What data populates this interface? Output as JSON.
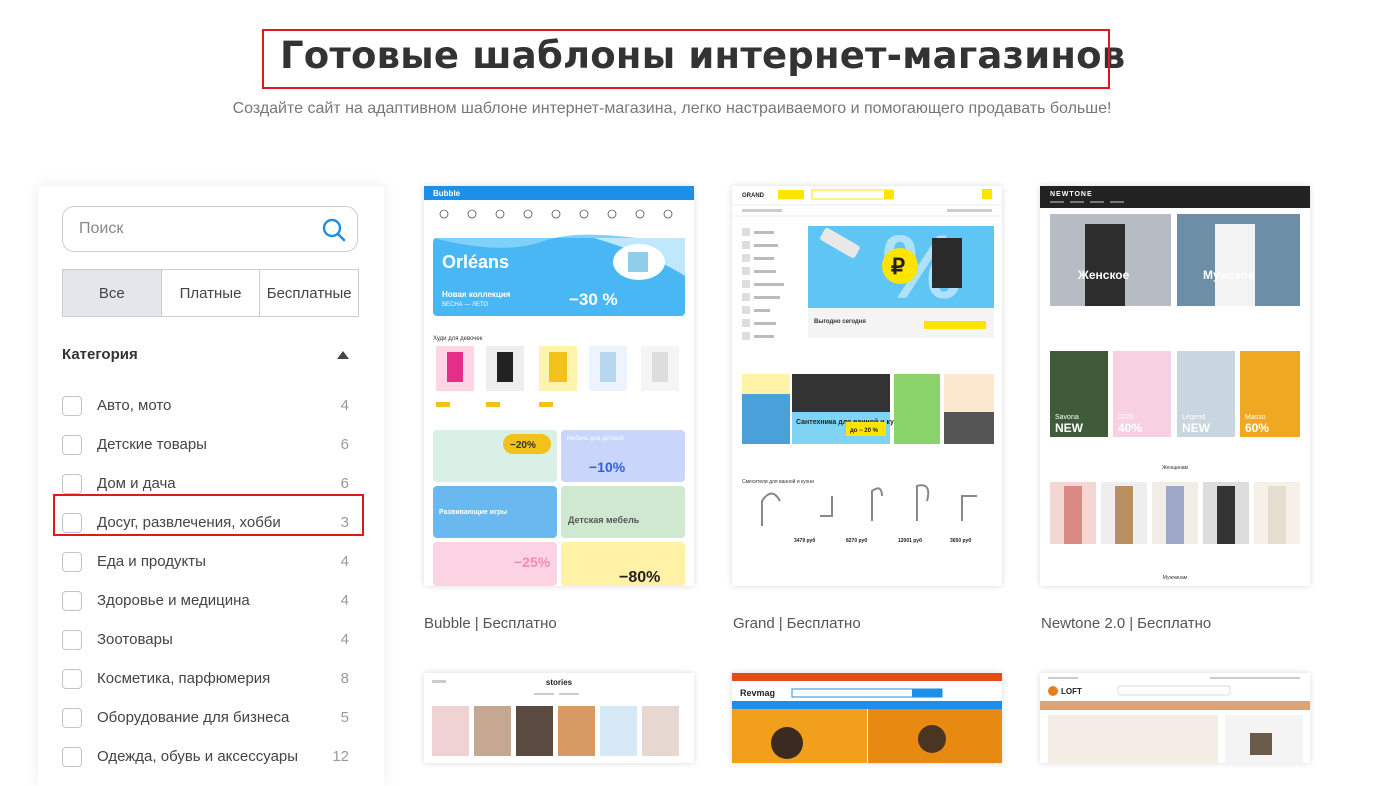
{
  "header": {
    "title": "Готовые шаблоны интернет-магазинов",
    "subtitle": "Создайте сайт на адаптивном шаблоне интернет-магазина, легко настраиваемого и помогающего продавать больше!"
  },
  "sidebar": {
    "search": {
      "placeholder": "Поиск",
      "icon": "search-icon"
    },
    "filters": [
      {
        "label": "Все",
        "active": true
      },
      {
        "label": "Платные",
        "active": false
      },
      {
        "label": "Бесплатные",
        "active": false
      }
    ],
    "category_heading": "Категория",
    "categories": [
      {
        "label": "Авто, мото",
        "count": "4"
      },
      {
        "label": "Детские товары",
        "count": "6"
      },
      {
        "label": "Дом и дача",
        "count": "6"
      },
      {
        "label": "Досуг, развлечения, хобби",
        "count": "3"
      },
      {
        "label": "Еда и продукты",
        "count": "4"
      },
      {
        "label": "Здоровье и медицина",
        "count": "4"
      },
      {
        "label": "Зоотовары",
        "count": "4"
      },
      {
        "label": "Косметика, парфюмерия",
        "count": "8"
      },
      {
        "label": "Оборудование для бизнеса",
        "count": "5"
      },
      {
        "label": "Одежда, обувь и аксессуары",
        "count": "12"
      }
    ]
  },
  "templates": [
    {
      "name": "Bubble",
      "price": "Бесплатно",
      "preview": {
        "logo": "Bubble",
        "banner_title": "Orléans",
        "banner_sub": "Новая коллекция",
        "banner_sub2": "ВЕСНА — ЛЕТО",
        "discount": "−30 %",
        "section": "Худи для девочек",
        "promo1": "−20%",
        "promo2": "Мебель для детской",
        "promo3": "−10%",
        "promo4": "Развивающие игры",
        "promo5": "Детская мебель",
        "promo6": "−25%",
        "promo7": "−80%"
      }
    },
    {
      "name": "Grand",
      "price": "Бесплатно",
      "preview": {
        "logo": "GRAND",
        "banner_text": "Выгодно сегодня",
        "promo": "Сантехника для ванной и кухни",
        "promo_discount": "до − 20 %",
        "section": "Смесители для ванной и кухни",
        "prices": [
          "3479 руб",
          "8270 руб",
          "12001 руб",
          "3650 руб"
        ]
      }
    },
    {
      "name": "Newtone 2.0",
      "price": "Бесплатно",
      "preview": {
        "logo": "NEWTONE",
        "women": "Женское",
        "men": "Мужское",
        "tiles": [
          "NEW",
          "40%",
          "NEW",
          "60%"
        ],
        "tile_names": [
          "Savona",
          "2020",
          "Legend",
          "Masso"
        ],
        "section": "Женщинам",
        "section2": "Мужчинам"
      }
    },
    {
      "name": "",
      "price": "",
      "preview": {
        "logo": "stories"
      }
    },
    {
      "name": "",
      "price": "",
      "preview": {
        "logo": "Revmag"
      }
    },
    {
      "name": "",
      "price": "",
      "preview": {
        "logo": "LOFT"
      }
    }
  ],
  "colors": {
    "highlight": "#e0191e",
    "bubble_blue": "#1e8fe6",
    "grand_yellow": "#ffe400",
    "text": "#333333"
  }
}
